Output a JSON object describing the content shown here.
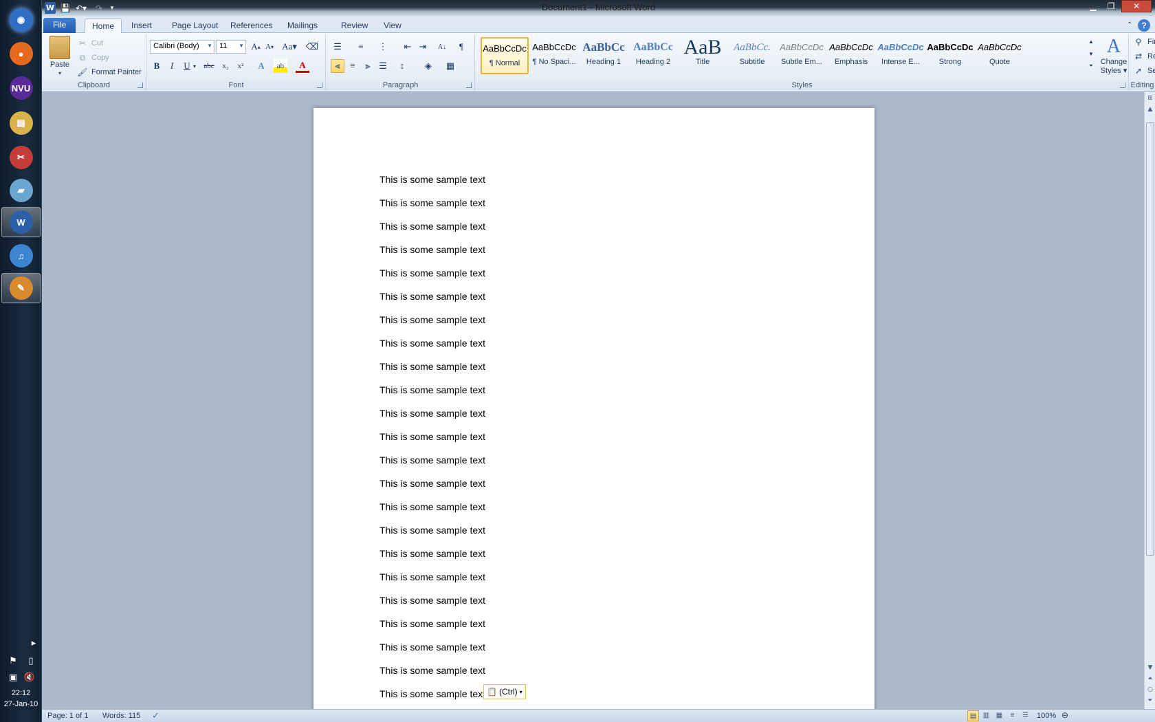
{
  "taskbar": {
    "apps": [
      {
        "name": "start-orb-icon",
        "glyph": "◉",
        "color": "#2f6fc3"
      },
      {
        "name": "firefox-icon",
        "glyph": "●",
        "color": "#e66a1e"
      },
      {
        "name": "nvu-icon",
        "glyph": "NVU",
        "color": "#5b2a9a"
      },
      {
        "name": "file-explorer-icon",
        "glyph": "▤",
        "color": "#d9b24a"
      },
      {
        "name": "snipping-tool-icon",
        "glyph": "✂",
        "color": "#c43b3b"
      },
      {
        "name": "notepad-icon",
        "glyph": "▰",
        "color": "#6aa6cf"
      },
      {
        "name": "word-icon",
        "glyph": "W",
        "color": "#2b5fa8"
      },
      {
        "name": "itunes-icon",
        "glyph": "♫",
        "color": "#3d84d1"
      },
      {
        "name": "paint-icon",
        "glyph": "✎",
        "color": "#d78b2c"
      }
    ],
    "time": "22:12",
    "date": "27-Jan-10"
  },
  "window": {
    "title": "Document1  -  Microsoft Word"
  },
  "tabs": [
    "File",
    "Home",
    "Insert",
    "Page Layout",
    "References",
    "Mailings",
    "Review",
    "View"
  ],
  "clipboard": {
    "label": "Clipboard",
    "paste": "Paste",
    "cut": "Cut",
    "copy": "Copy",
    "format_painter": "Format Painter"
  },
  "font": {
    "label": "Font",
    "family": "Calibri (Body)",
    "size": "11"
  },
  "paragraph": {
    "label": "Paragraph"
  },
  "styles": {
    "label": "Styles",
    "items": [
      {
        "preview": "AaBbCcDc",
        "name": "¶ Normal"
      },
      {
        "preview": "AaBbCcDc",
        "name": "¶ No Spaci..."
      },
      {
        "preview": "AaBbCc",
        "name": "Heading 1"
      },
      {
        "preview": "AaBbCc",
        "name": "Heading 2"
      },
      {
        "preview": "AaB",
        "name": "Title"
      },
      {
        "preview": "AaBbCc.",
        "name": "Subtitle"
      },
      {
        "preview": "AaBbCcDc",
        "name": "Subtle Em..."
      },
      {
        "preview": "AaBbCcDc",
        "name": "Emphasis"
      },
      {
        "preview": "AaBbCcDc",
        "name": "Intense E..."
      },
      {
        "preview": "AaBbCcDc",
        "name": "Strong"
      },
      {
        "preview": "AaBbCcDc",
        "name": "Quote"
      }
    ],
    "change_styles_line1": "Change",
    "change_styles_line2": "Styles"
  },
  "editing": {
    "label": "Editing",
    "find": "Find",
    "replace": "Replace",
    "select": "Select"
  },
  "document": {
    "lines": [
      "This is some sample text",
      "This is some sample text",
      "This is some sample text",
      "This is some sample text",
      "This is some sample text",
      "This is some sample text",
      "This is some sample text",
      "This is some sample text",
      "This is some sample text",
      "This is some sample text",
      "This is some sample text",
      "This is some sample text",
      "This is some sample text",
      "This is some sample text",
      "This is some sample text",
      "This is some sample text",
      "This is some sample text",
      "This is some sample text",
      "This is some sample text",
      "This is some sample text",
      "This is some sample text",
      "This is some sample text",
      "This is some sample text"
    ],
    "paste_options": "(Ctrl)"
  },
  "status": {
    "page": "Page: 1 of 1",
    "words": "Words: 115",
    "zoom": "100%"
  }
}
